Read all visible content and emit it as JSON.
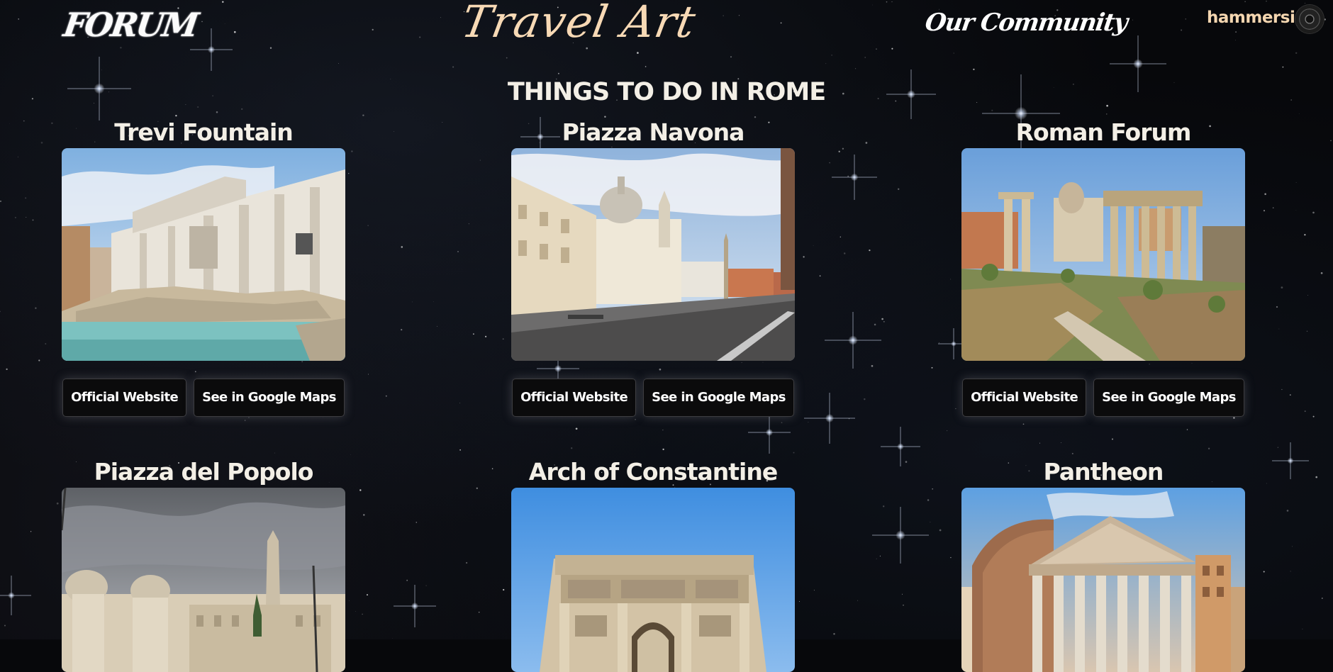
{
  "header": {
    "logo_text": "FORUM",
    "site_title": "Travel Art",
    "community_link": "Our Community",
    "username": "hammersign"
  },
  "page": {
    "heading": "THINGS TO DO IN ROME"
  },
  "attractions": [
    {
      "title": "Trevi Fountain",
      "official_label": "Official Website",
      "maps_label": "See in Google Maps"
    },
    {
      "title": "Piazza Navona",
      "official_label": "Official Website",
      "maps_label": "See in Google Maps"
    },
    {
      "title": "Roman Forum",
      "official_label": "Official Website",
      "maps_label": "See in Google Maps"
    },
    {
      "title": "Piazza del Popolo"
    },
    {
      "title": "Arch of Constantine"
    },
    {
      "title": "Pantheon"
    }
  ],
  "colors": {
    "background": "#07080b",
    "title_accent": "#f7d9b5",
    "text": "#f3efe6",
    "button_bg": "#0b0b0c"
  }
}
